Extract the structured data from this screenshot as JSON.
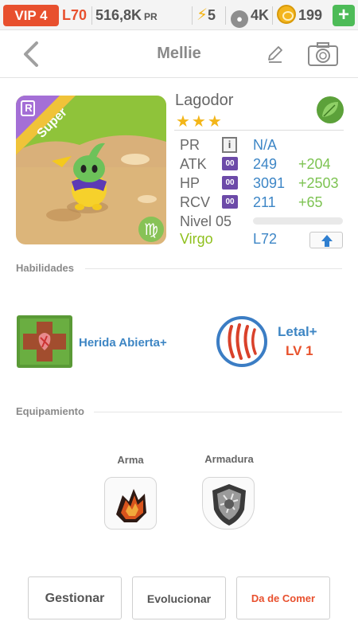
{
  "status": {
    "vip": "VIP 4",
    "level": "L70",
    "pr": "516,8K",
    "pr_unit": "PR",
    "energy": "5",
    "paws": "4K",
    "coins": "199",
    "add_icon": "plus-icon"
  },
  "nav": {
    "title": "Mellie",
    "back_icon": "chevron-left-icon",
    "edit_icon": "pencil-icon",
    "camera_icon": "camera-icon"
  },
  "pet": {
    "rarity_letter": "R",
    "banner": "Super",
    "name": "Lagodor",
    "stars": "★★★",
    "element_icon": "leaf-icon",
    "zodiac_glyph": "♍",
    "stats": [
      {
        "label": "PR",
        "value": "N/A",
        "bonus": ""
      },
      {
        "label": "ATK",
        "badge": "00",
        "value": "249",
        "bonus": "+204"
      },
      {
        "label": "HP",
        "badge": "00",
        "value": "3091",
        "bonus": "+2503"
      },
      {
        "label": "RCV",
        "badge": "00",
        "value": "211",
        "bonus": "+65"
      }
    ],
    "info_glyph": "i",
    "level_label": "Nivel 05",
    "level_progress": 0,
    "zodiac": "Virgo",
    "max_level": "L72"
  },
  "sections": {
    "skills": "Habilidades",
    "equipment": "Equipamiento"
  },
  "skills": {
    "active": "Herida Abierta+",
    "leader": "Letal+",
    "leader_level": "LV 1"
  },
  "equipment": {
    "weapon": "Arma",
    "armor": "Armadura"
  },
  "buttons": {
    "manage": "Gestionar",
    "evolve": "Evolucionar",
    "feed": "Da de Comer"
  },
  "colors": {
    "accent_red": "#e8502e",
    "blue": "#3d86c6",
    "green": "#7dc352",
    "purple": "#6c4aa8",
    "gold": "#f3b619"
  }
}
